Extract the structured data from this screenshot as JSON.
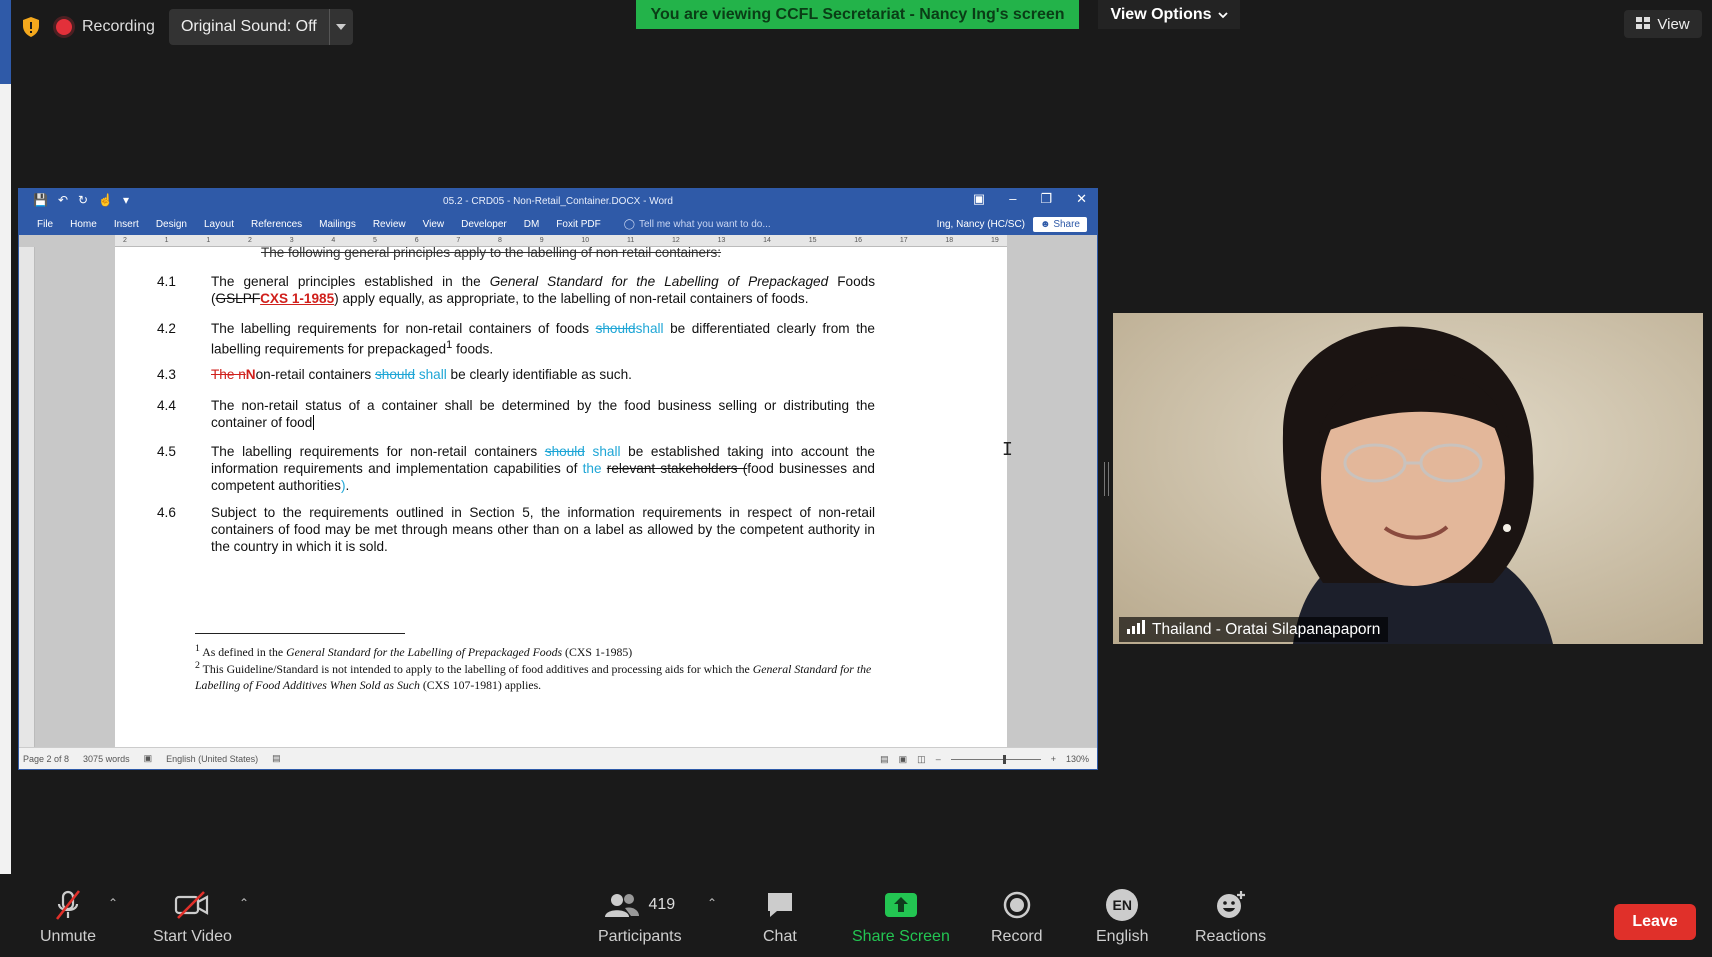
{
  "top": {
    "recording_label": "Recording",
    "original_sound_label": "Original Sound: Off",
    "viewing_banner": "You are viewing CCFL Secretariat - Nancy Ing's screen",
    "view_options_label": "View Options",
    "view_label": "View"
  },
  "word": {
    "window_title": "05.2 - CRD05 - Non-Retail_Container.DOCX - Word",
    "tabs": [
      "File",
      "Home",
      "Insert",
      "Design",
      "Layout",
      "References",
      "Mailings",
      "Review",
      "View",
      "Developer",
      "DM",
      "Foxit PDF"
    ],
    "tell_me": "Tell me what you want to do...",
    "user": "Ing, Nancy (HC/SC)",
    "share_label": "Share",
    "ruler_numbers": [
      "2",
      "1",
      "1",
      "2",
      "3",
      "4",
      "5",
      "6",
      "7",
      "8",
      "9",
      "10",
      "11",
      "12",
      "13",
      "14",
      "15",
      "16",
      "17",
      "18",
      "19"
    ],
    "cut_line": "The following general principles apply to the labelling of non retail containers:",
    "p41": {
      "num": "4.1",
      "a": "The general principles established in the ",
      "italic": "General Standard for the Labelling of Prepackaged",
      "b": " Foods (",
      "del": "GSLPF",
      "ins": "CXS 1-1985",
      "c": ") apply equally, as appropriate, to the labelling of non-retail containers of foods."
    },
    "p42": {
      "num": "4.2",
      "a": "The labelling requirements for non-retail containers of foods ",
      "del": "should",
      "ins": "shall",
      "b": "  be differentiated clearly from the labelling requirements for prepackaged",
      "sup": "1",
      "c": " foods."
    },
    "p43": {
      "num": "4.3",
      "del1": "The n",
      "ins1": "N",
      "a": "on-retail containers ",
      "del2": "should",
      "ins2": " shall",
      "b": " be clearly identifiable as such."
    },
    "p44": {
      "num": "4.4",
      "text": "The non-retail status of a container shall be determined by the food business selling or distributing the container of food"
    },
    "p45": {
      "num": "4.5",
      "a": "The labelling requirements for non-retail containers ",
      "del1": "should",
      "ins1": " shall",
      "b": " be established taking into account the information requirements and implementation capabilities of ",
      "ins2": "the",
      "c": " ",
      "del2": "relevant stakeholders (",
      "d": "food businesses and competent authorities",
      "ins3": ")",
      "e": "."
    },
    "p46": {
      "num": "4.6",
      "text": "Subject to the requirements outlined in Section 5, the information requirements in respect of non-retail containers of food may be met through means other than on a label as allowed by the competent authority in the country in which it is sold."
    },
    "fn1": {
      "sup": "1",
      "a": " As defined in the ",
      "italic": "General Standard for the Labelling of Prepackaged Foods",
      "b": " (CXS 1-1985)"
    },
    "fn2": {
      "sup": "2",
      "a": " This Guideline/Standard is not intended to apply to the labelling of food additives and processing aids for which the ",
      "italic": "General Standard for the Labelling of Food Additives When Sold as Such",
      "b": " (CXS 107-1981) applies."
    },
    "status": {
      "page": "Page 2 of 8",
      "words": "3075 words",
      "language": "English (United States)",
      "zoom": "130%"
    }
  },
  "video": {
    "participant_name": "Thailand - Oratai Silapanapaporn"
  },
  "toolbar": {
    "unmute": "Unmute",
    "start_video": "Start Video",
    "participants": "Participants",
    "participant_count": "419",
    "chat": "Chat",
    "share_screen": "Share Screen",
    "record": "Record",
    "english": "English",
    "english_badge": "EN",
    "reactions": "Reactions",
    "leave": "Leave"
  },
  "colors": {
    "banner_green": "#23b34a",
    "word_blue": "#2f5aa8",
    "share_screen_green": "#23c552",
    "leave_red": "#e0302a",
    "track_insert_red": "#d0201c",
    "track_cyan": "#1fa6d6"
  }
}
